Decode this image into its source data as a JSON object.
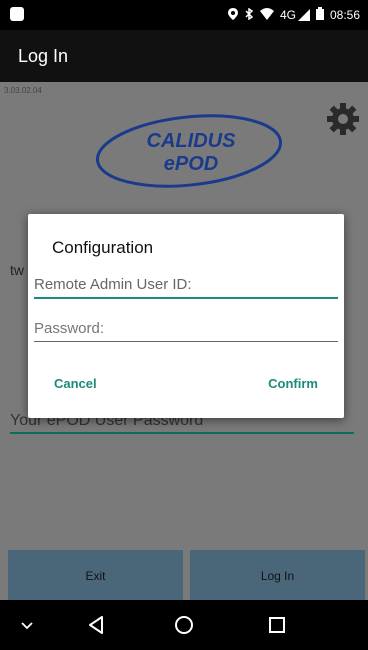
{
  "statusbar": {
    "time": "08:56",
    "network": "4G"
  },
  "appbar": {
    "title": "Log In"
  },
  "content": {
    "version": "3.03.02.04",
    "logo_line1": "CALIDUS",
    "logo_line2": "ePOD",
    "bg_text_tw": "tw",
    "password_placeholder": "Your ePOD User Password",
    "exit_label": "Exit",
    "login_label": "Log In"
  },
  "dialog": {
    "title": "Configuration",
    "userid_placeholder": "Remote Admin User ID:",
    "password_placeholder": "Password:",
    "cancel_label": "Cancel",
    "confirm_label": "Confirm"
  },
  "colors": {
    "accent": "#1c8a7c",
    "appbar": "#111111",
    "content_bg": "#7a7a7a",
    "button_bg": "#4a6679",
    "logo_blue": "#1a3b8c"
  },
  "icons": {
    "status_left": "notification-icon",
    "location": "location-icon",
    "bluetooth": "bluetooth-icon",
    "wifi": "wifi-icon",
    "signal": "signal-icon",
    "battery": "battery-icon",
    "gear": "gear-icon",
    "nav_down": "chevron-down-icon",
    "nav_back": "back-icon",
    "nav_home": "home-icon",
    "nav_recents": "recents-icon"
  }
}
